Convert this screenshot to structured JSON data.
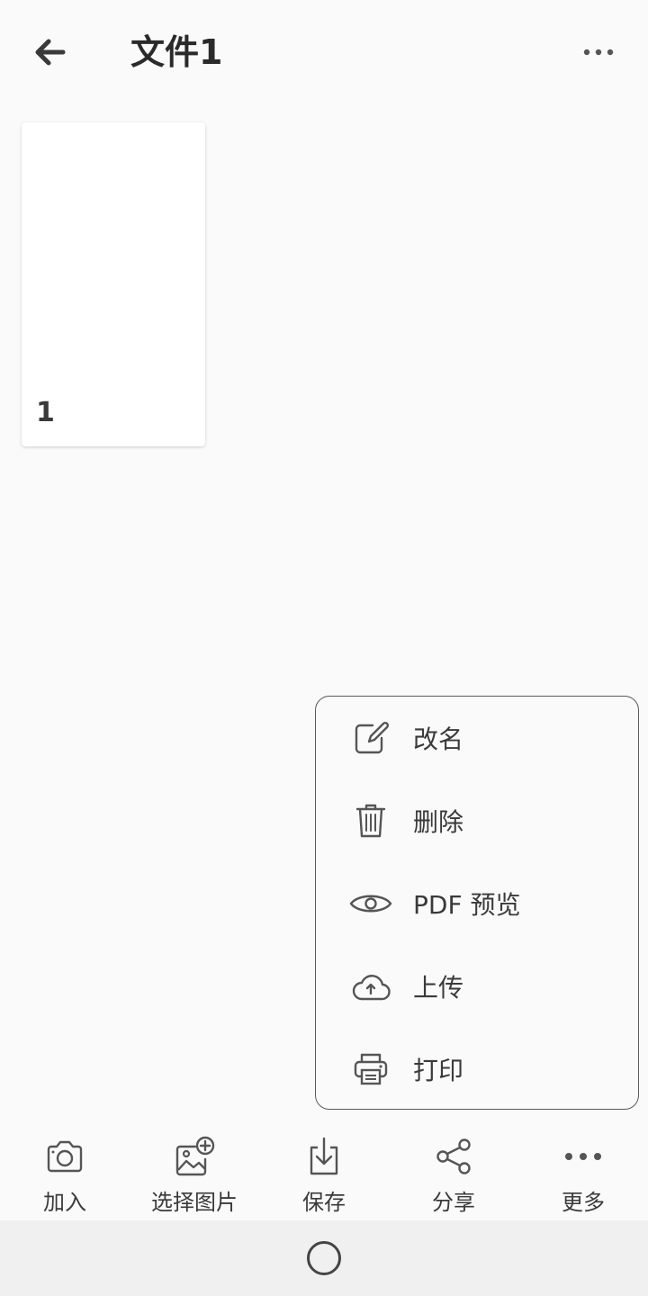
{
  "header": {
    "title": "文件1",
    "back_icon": "arrow-left-icon",
    "more_icon": "more-horizontal-icon"
  },
  "pages": [
    {
      "number": "1"
    }
  ],
  "popup_menu": {
    "items": [
      {
        "label": "改名",
        "icon": "edit-icon"
      },
      {
        "label": "删除",
        "icon": "trash-icon"
      },
      {
        "label": "PDF 预览",
        "icon": "eye-icon"
      },
      {
        "label": "上传",
        "icon": "cloud-upload-icon"
      },
      {
        "label": "打印",
        "icon": "printer-icon"
      }
    ]
  },
  "toolbar": {
    "items": [
      {
        "label": "加入",
        "icon": "camera-icon"
      },
      {
        "label": "选择图片",
        "icon": "add-image-icon"
      },
      {
        "label": "保存",
        "icon": "download-icon"
      },
      {
        "label": "分享",
        "icon": "share-icon"
      },
      {
        "label": "更多",
        "icon": "more-horizontal-icon"
      }
    ]
  },
  "colors": {
    "background": "#fafafa",
    "text": "#333333",
    "icon": "#555555",
    "border": "#5a5a5a"
  }
}
